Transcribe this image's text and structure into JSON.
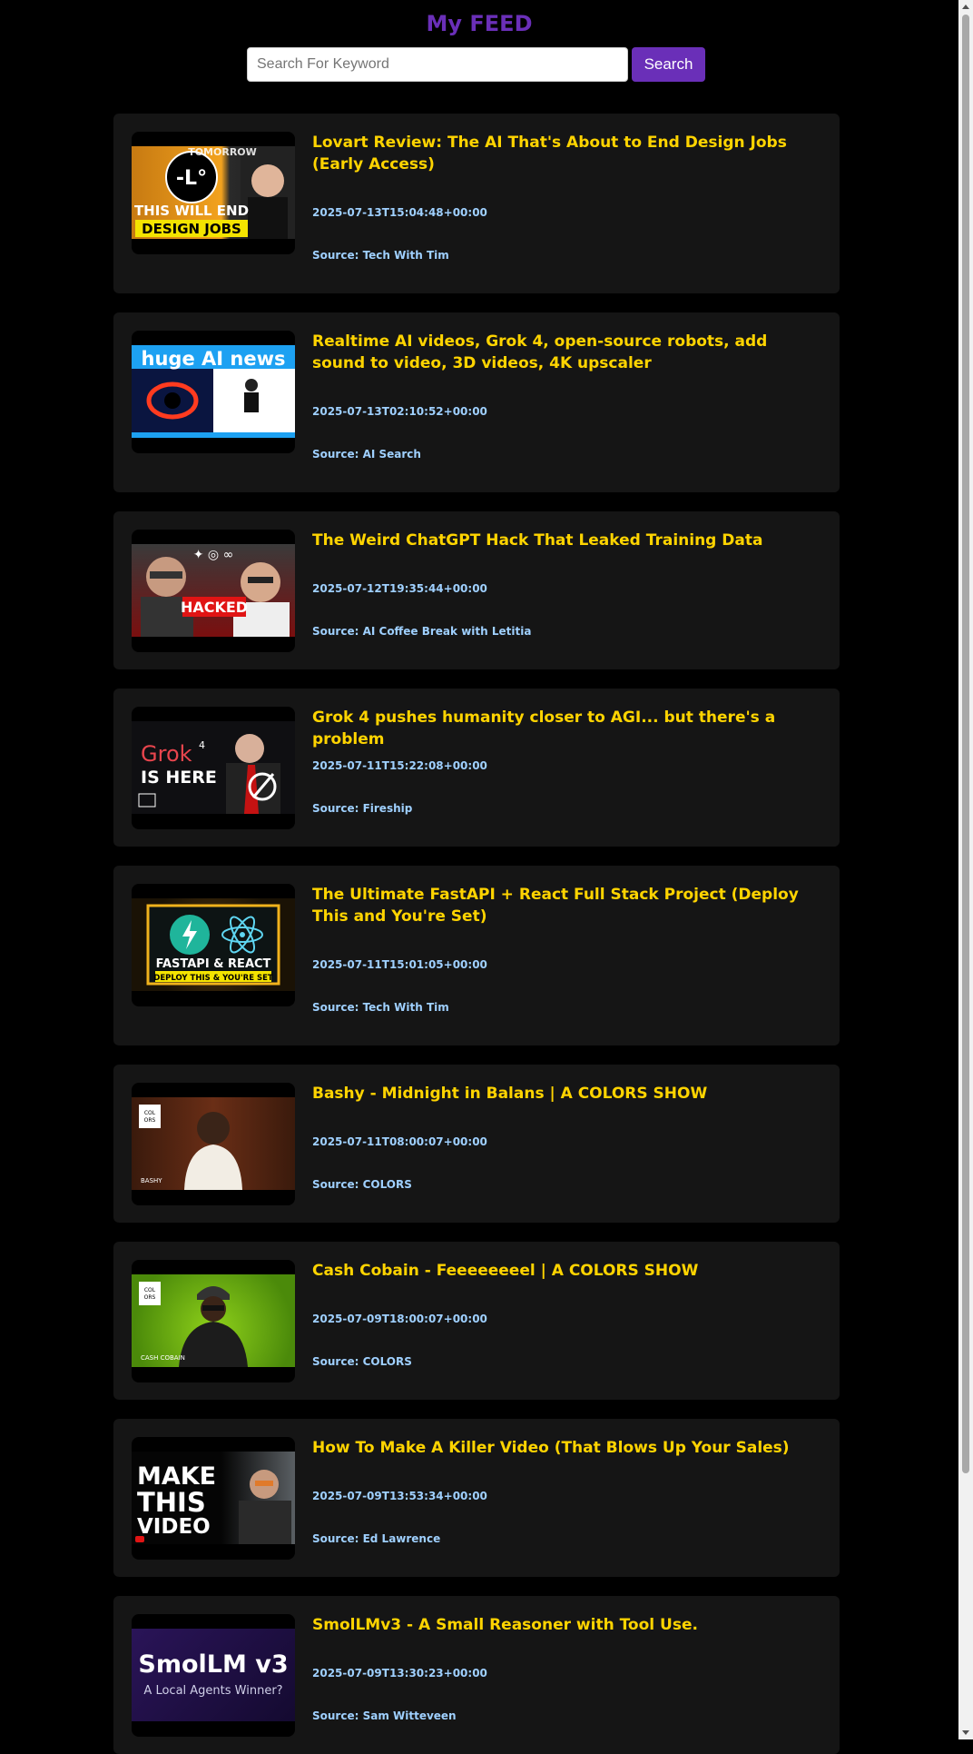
{
  "header": {
    "title": "My FEED",
    "search_placeholder": "Search For Keyword",
    "search_value": "",
    "search_button": "Search"
  },
  "colors": {
    "accent": "#6a2fb8",
    "title_text": "#ffd400",
    "meta_text": "#9fd0ff",
    "card_bg": "#151515",
    "page_bg": "#000000"
  },
  "feed": [
    {
      "title": "Lovart Review: The AI That's About to End Design Jobs (Early Access)",
      "date": "2025-07-13T15:04:48+00:00",
      "source": "Source: Tech With Tim",
      "thumb_text": [
        "TOMORROW",
        "THIS WILL END",
        "DESIGN JOBS"
      ]
    },
    {
      "title": "Realtime AI videos, Grok 4, open-source robots, add sound to video, 3D videos, 4K upscaler",
      "date": "2025-07-13T02:10:52+00:00",
      "source": "Source: AI Search",
      "thumb_text": [
        "huge AI news"
      ]
    },
    {
      "title": "The Weird ChatGPT Hack That Leaked Training Data",
      "date": "2025-07-12T19:35:44+00:00",
      "source": "Source: AI Coffee Break with Letitia",
      "thumb_text": [
        "HACKED"
      ]
    },
    {
      "title": "Grok 4 pushes humanity closer to AGI... but there's a problem",
      "date": "2025-07-11T15:22:08+00:00",
      "source": "Source: Fireship",
      "thumb_text": [
        "Grok",
        "IS HERE"
      ]
    },
    {
      "title": "The Ultimate FastAPI + React Full Stack Project (Deploy This and You're Set)",
      "date": "2025-07-11T15:01:05+00:00",
      "source": "Source: Tech With Tim",
      "thumb_text": [
        "FASTAPI & REACT",
        "DEPLOY THIS & YOU'RE SET"
      ]
    },
    {
      "title": "Bashy - Midnight in Balans | A COLORS SHOW",
      "date": "2025-07-11T08:00:07+00:00",
      "source": "Source: COLORS",
      "thumb_text": [
        "BASHY"
      ]
    },
    {
      "title": "Cash Cobain - Feeeeeeeel | A COLORS SHOW",
      "date": "2025-07-09T18:00:07+00:00",
      "source": "Source: COLORS",
      "thumb_text": [
        "CASH COBAIN"
      ]
    },
    {
      "title": "How To Make A Killer Video (That Blows Up Your Sales)",
      "date": "2025-07-09T13:53:34+00:00",
      "source": "Source: Ed Lawrence",
      "thumb_text": [
        "MAKE",
        "THIS",
        "VIDEO"
      ]
    },
    {
      "title": "SmolLMv3 - A Small Reasoner with Tool Use.",
      "date": "2025-07-09T13:30:23+00:00",
      "source": "Source: Sam Witteveen",
      "thumb_text": [
        "SmolLM v3",
        "A Local Agents Winner?"
      ]
    }
  ]
}
